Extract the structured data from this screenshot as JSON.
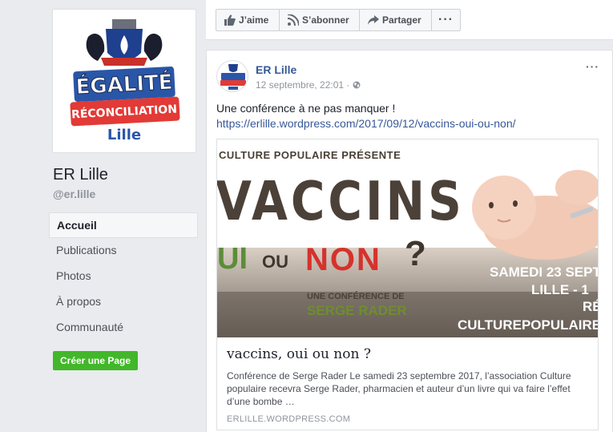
{
  "sidebar": {
    "logo_text": {
      "line1": "ÉGALITÉ",
      "line2": "RÉCONCILIATION",
      "line3": "Lille"
    },
    "page_name": "ER Lille",
    "page_handle": "@er.lille",
    "nav_items": [
      {
        "label": "Accueil",
        "active": true
      },
      {
        "label": "Publications",
        "active": false
      },
      {
        "label": "Photos",
        "active": false
      },
      {
        "label": "À propos",
        "active": false
      },
      {
        "label": "Communauté",
        "active": false
      }
    ],
    "create_page_label": "Créer une Page"
  },
  "action_bar": {
    "like_label": "J’aime",
    "subscribe_label": "S’abonner",
    "share_label": "Partager",
    "more_label": "···"
  },
  "post": {
    "author": "ER Lille",
    "timestamp": "12 septembre, 22:01 · ",
    "privacy_icon": "globe-icon",
    "menu_label": "···",
    "text": "Une conférence à ne pas manquer !",
    "link": "https://erlille.wordpress.com/2017/09/12/vaccins-oui-ou-non/",
    "preview": {
      "image_text": {
        "top": "CULTURE POPULAIRE PRÉSENTE",
        "big": "VACCINS",
        "oui": "UI",
        "ou": "OU",
        "non": "NON",
        "question": "?",
        "conference": "UNE CONFÉRENCE DE",
        "speaker": "SERGE RADER",
        "date": "SAMEDI 23 SEPT",
        "city": "LILLE - 1",
        "re": "RÉ",
        "url": "CULTUREPOPULAIRE@"
      },
      "title": "vaccins, oui ou non ?",
      "description": "Conférence de Serge Rader Le samedi 23 septembre 2017, l’association Culture populaire recevra Serge Rader, pharmacien et auteur d’un livre qui va faire l’effet d’une bombe …",
      "domain": "ERLILLE.WORDPRESS.COM"
    }
  },
  "colors": {
    "background": "#e9ebee",
    "link_blue": "#365899",
    "green_button": "#42b72a",
    "non_red": "#d6322c",
    "oui_green": "#5b8d3a"
  }
}
